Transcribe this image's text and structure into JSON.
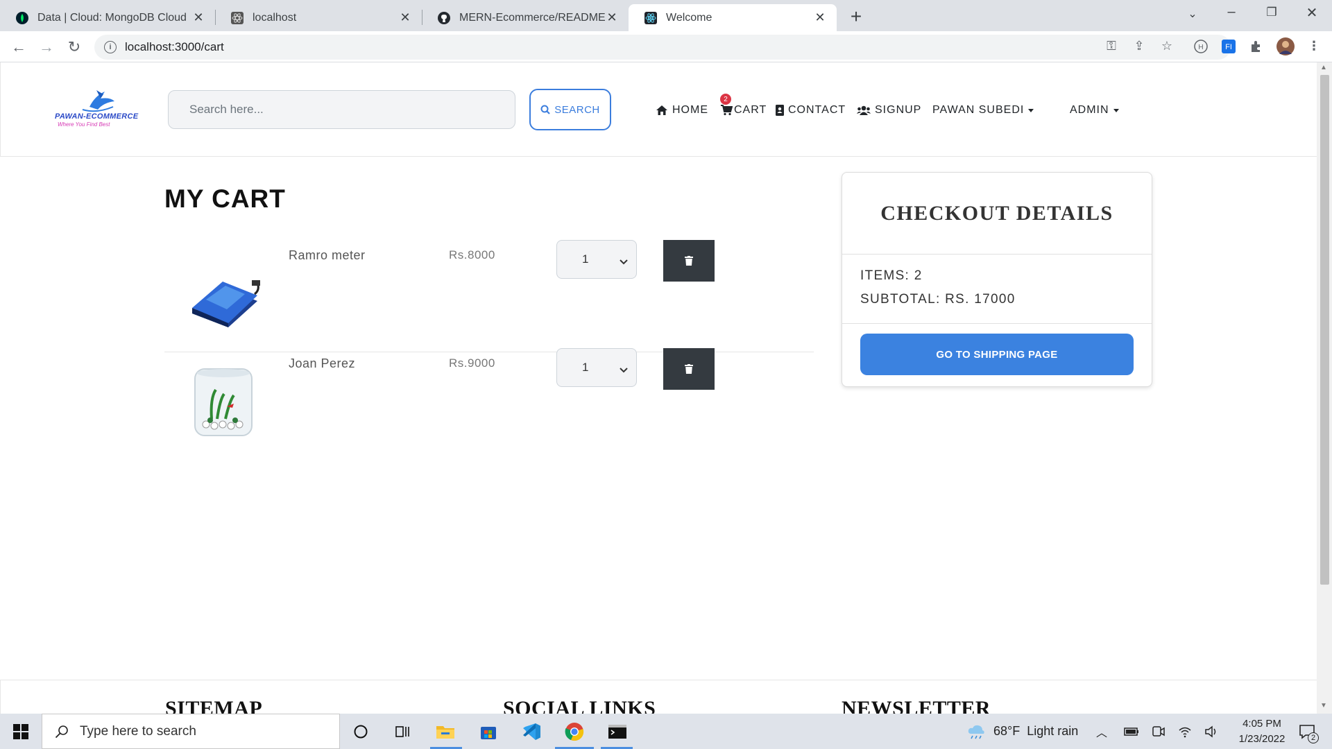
{
  "browser": {
    "tabs": [
      {
        "title": "Data | Cloud: MongoDB Cloud",
        "icon": "mongodb-leaf-icon",
        "active": false
      },
      {
        "title": "localhost",
        "icon": "react-atom-icon",
        "active": false
      },
      {
        "title": "MERN-Ecommerce/README.md",
        "icon": "github-icon",
        "active": false
      },
      {
        "title": "Welcome",
        "icon": "react-atom-icon",
        "active": true
      }
    ],
    "url": "localhost:3000/cart"
  },
  "site": {
    "logo_text": "PAWAN-ECOMMERCE",
    "logo_tagline": "Where You Find Best",
    "search_placeholder": "Search here...",
    "search_button": "SEARCH",
    "nav": {
      "home": "HOME",
      "cart": "CART",
      "cart_count": "2",
      "contact": "CONTACT",
      "signup": "SIGNUP",
      "user": "PAWAN SUBEDI",
      "admin": "ADMIN"
    }
  },
  "cart": {
    "title": "MY CART",
    "items": [
      {
        "name": "Ramro meter",
        "price": "Rs.8000",
        "qty": "1",
        "image": "aquarium-pump-image"
      },
      {
        "name": "Joan Perez",
        "price": "Rs.9000",
        "qty": "1",
        "image": "fish-tank-image"
      }
    ]
  },
  "checkout": {
    "title": "CHECKOUT DETAILS",
    "items_line": "ITEMS: 2",
    "subtotal_line": "SUBTOTAL: RS. 17000",
    "button": "GO TO SHIPPING PAGE"
  },
  "footer": {
    "sitemap": "SITEMAP",
    "social": "SOCIAL LINKS",
    "newsletter": "NEWSLETTER"
  },
  "taskbar": {
    "search_placeholder": "Type here to search",
    "weather_temp": "68°F",
    "weather_desc": "Light rain",
    "time": "4:05 PM",
    "date": "1/23/2022",
    "notifications": "2"
  },
  "colors": {
    "accent": "#3b82e0",
    "badge": "#dc3545",
    "delete_button": "#343a40"
  }
}
